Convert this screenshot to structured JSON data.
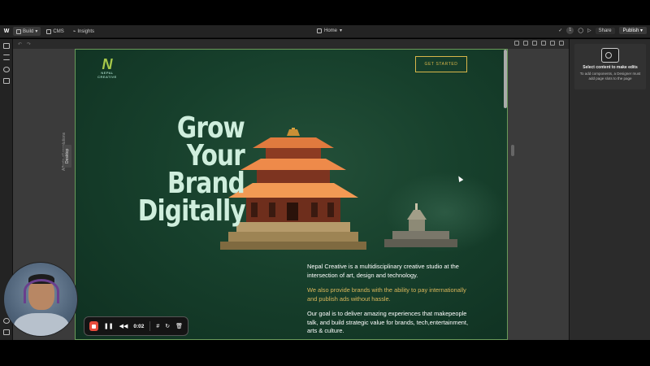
{
  "app": {
    "logo": "W",
    "nav": {
      "build": "Build",
      "cms": "CMS",
      "insights": "Insights"
    },
    "page_selector": "Home",
    "badge_count": "1",
    "share_label": "Share",
    "publish_label": "Publish"
  },
  "canvas": {
    "breakpoint_label": "Desktop",
    "affects_label": "Affects all resolutions"
  },
  "site": {
    "logo_mark": "N",
    "logo_name": "NEPAL\nCREATIVE",
    "cta": "GET STARTED",
    "hero_lines": [
      "Grow",
      "Your",
      "Brand",
      "Digitally"
    ],
    "para1": "Nepal Creative is a multidisciplinary creative studio at the intersection of art, design and technology.",
    "para2": "We also provide brands with the ability to pay internationally and publish ads without hassle.",
    "para3": "Our goal is to deliver amazing experiences that makepeople talk, and build strategic value for brands, tech,entertainment, arts & culture."
  },
  "right_panel": {
    "title": "Select content to make edits",
    "description": "To add components, a Designer must add page slots to the page"
  },
  "recorder": {
    "time": "0:02"
  },
  "colors": {
    "site_green": "#17402c",
    "cta_gold": "#d8b64a",
    "hero_text": "#cfeedd",
    "record_red": "#e74c3c"
  }
}
